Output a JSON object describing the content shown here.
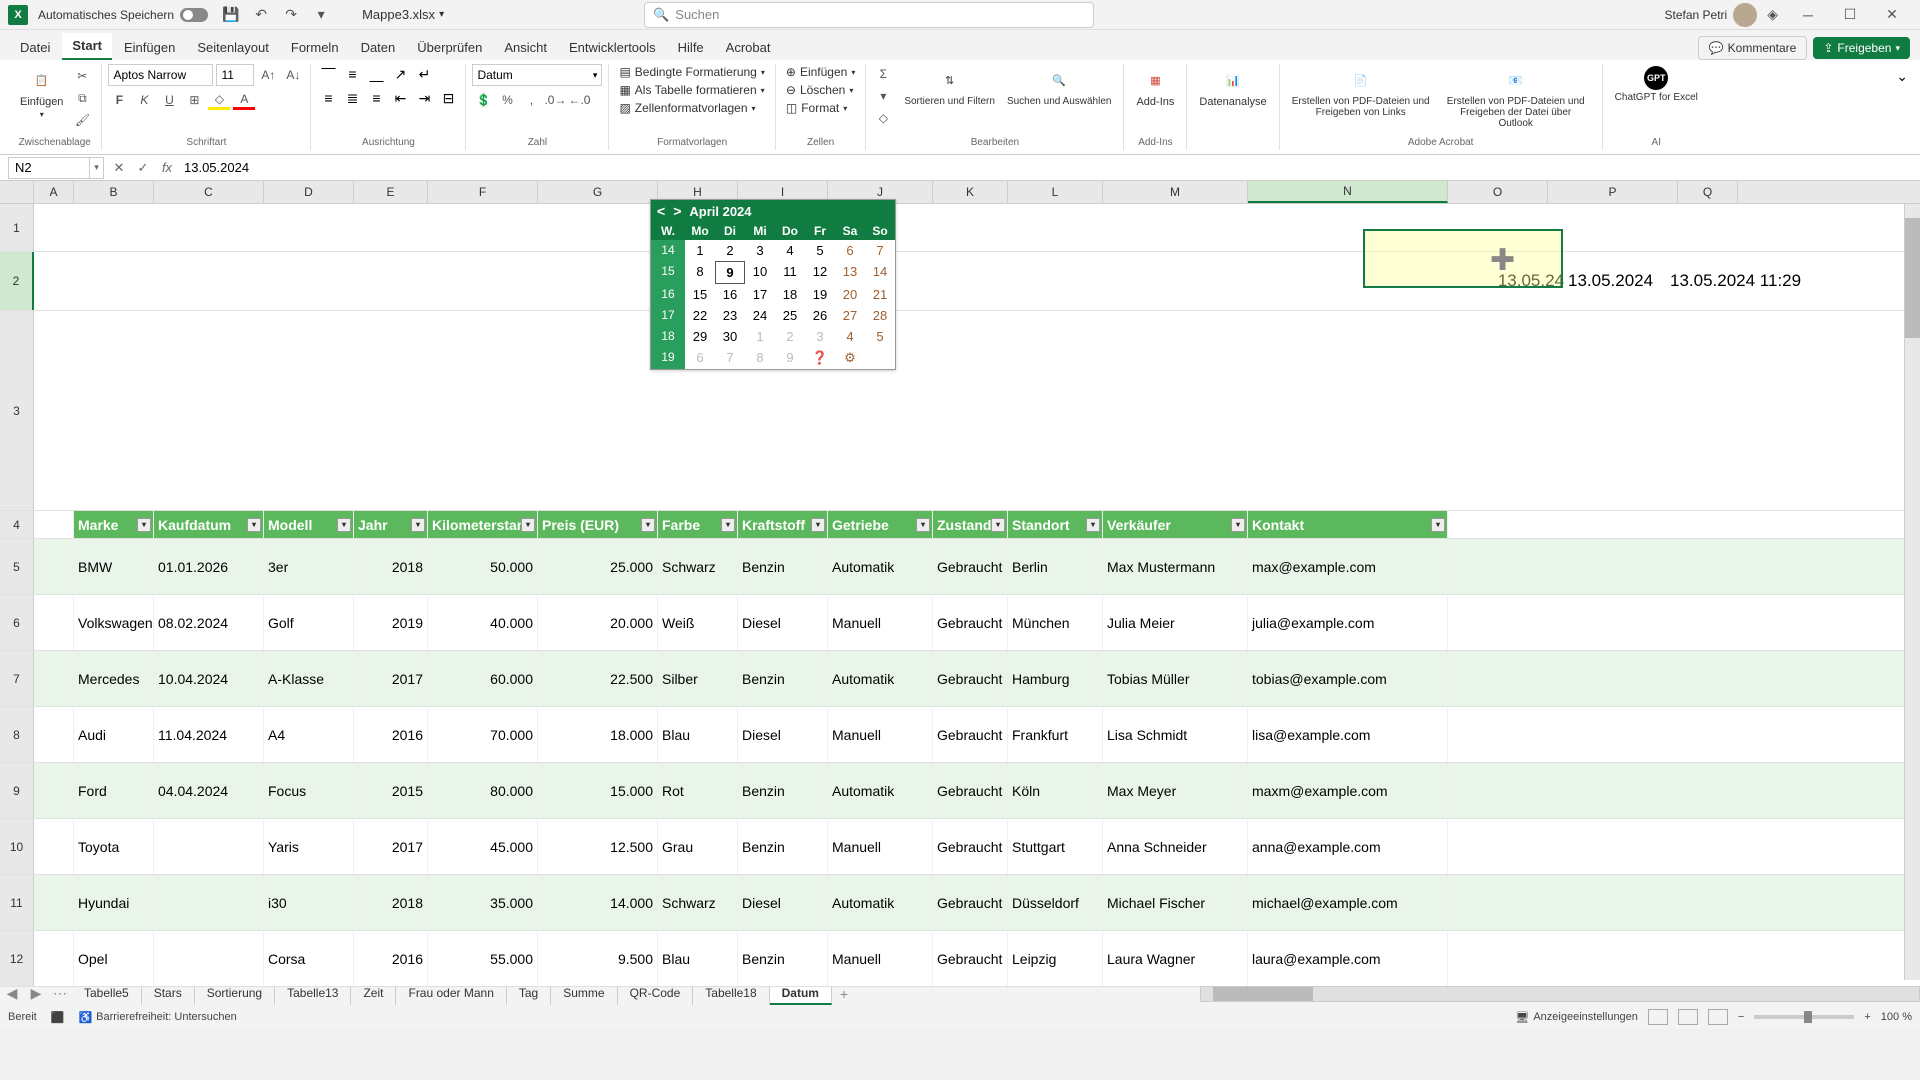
{
  "titlebar": {
    "autosave": "Automatisches Speichern",
    "filename": "Mappe3.xlsx",
    "search_placeholder": "Suchen",
    "user": "Stefan Petri"
  },
  "menubar": {
    "tabs": [
      "Datei",
      "Start",
      "Einfügen",
      "Seitenlayout",
      "Formeln",
      "Daten",
      "Überprüfen",
      "Ansicht",
      "Entwicklertools",
      "Hilfe",
      "Acrobat"
    ],
    "active": "Start",
    "comments": "Kommentare",
    "share": "Freigeben"
  },
  "ribbon": {
    "clipboard": {
      "paste": "Einfügen",
      "group": "Zwischenablage"
    },
    "font": {
      "name": "Aptos Narrow",
      "size": "11",
      "group": "Schriftart"
    },
    "alignment": {
      "group": "Ausrichtung"
    },
    "number": {
      "format": "Datum",
      "group": "Zahl"
    },
    "styles": {
      "cond": "Bedingte Formatierung",
      "table": "Als Tabelle formatieren",
      "cell": "Zellenformatvorlagen",
      "group": "Formatvorlagen"
    },
    "cells": {
      "insert": "Einfügen",
      "delete": "Löschen",
      "format": "Format",
      "group": "Zellen"
    },
    "editing": {
      "sort": "Sortieren und Filtern",
      "find": "Suchen und Auswählen",
      "group": "Bearbeiten"
    },
    "addins": {
      "addins": "Add-Ins",
      "group": "Add-Ins"
    },
    "analysis": {
      "data": "Datenanalyse"
    },
    "acrobat": {
      "pdf1": "Erstellen von PDF-Dateien und Freigeben von Links",
      "pdf2": "Erstellen von PDF-Dateien und Freigeben der Datei über Outlook",
      "group": "Adobe Acrobat"
    },
    "ai": {
      "gpt": "ChatGPT for Excel",
      "group": "AI"
    }
  },
  "formula_bar": {
    "namebox": "N2",
    "fx": "fx",
    "value": "13.05.2024"
  },
  "columns": [
    "A",
    "B",
    "C",
    "D",
    "E",
    "F",
    "G",
    "H",
    "I",
    "J",
    "K",
    "L",
    "M",
    "N",
    "O",
    "P",
    "Q"
  ],
  "calendar": {
    "title": "April 2024",
    "days": [
      "W.",
      "Mo",
      "Di",
      "Mi",
      "Do",
      "Fr",
      "Sa",
      "So"
    ],
    "weeks": [
      {
        "wn": "14",
        "d": [
          "1",
          "2",
          "3",
          "4",
          "5",
          "6",
          "7"
        ]
      },
      {
        "wn": "15",
        "d": [
          "8",
          "9",
          "10",
          "11",
          "12",
          "13",
          "14"
        ]
      },
      {
        "wn": "16",
        "d": [
          "15",
          "16",
          "17",
          "18",
          "19",
          "20",
          "21"
        ]
      },
      {
        "wn": "17",
        "d": [
          "22",
          "23",
          "24",
          "25",
          "26",
          "27",
          "28"
        ]
      },
      {
        "wn": "18",
        "d": [
          "29",
          "30",
          "1",
          "2",
          "3",
          "4",
          "5"
        ]
      },
      {
        "wn": "19",
        "d": [
          "6",
          "7",
          "8",
          "9",
          "",
          ""
        ]
      }
    ]
  },
  "cells": {
    "N2": "13.05.24",
    "O2": "13.05.2024",
    "P2": "13.05.2024 11:29"
  },
  "table": {
    "headers": [
      "Marke",
      "Kaufdatum",
      "Modell",
      "Jahr",
      "Kilometerstand",
      "Preis (EUR)",
      "Farbe",
      "Kraftstoff",
      "Getriebe",
      "Zustand",
      "Standort",
      "Verkäufer",
      "Kontakt"
    ],
    "rows": [
      [
        "BMW",
        "01.01.2026",
        "3er",
        "2018",
        "50.000",
        "25.000",
        "Schwarz",
        "Benzin",
        "Automatik",
        "Gebraucht",
        "Berlin",
        "Max Mustermann",
        "max@example.com"
      ],
      [
        "Volkswagen",
        "08.02.2024",
        "Golf",
        "2019",
        "40.000",
        "20.000",
        "Weiß",
        "Diesel",
        "Manuell",
        "Gebraucht",
        "München",
        "Julia Meier",
        "julia@example.com"
      ],
      [
        "Mercedes",
        "10.04.2024",
        "A-Klasse",
        "2017",
        "60.000",
        "22.500",
        "Silber",
        "Benzin",
        "Automatik",
        "Gebraucht",
        "Hamburg",
        "Tobias Müller",
        "tobias@example.com"
      ],
      [
        "Audi",
        "11.04.2024",
        "A4",
        "2016",
        "70.000",
        "18.000",
        "Blau",
        "Diesel",
        "Manuell",
        "Gebraucht",
        "Frankfurt",
        "Lisa Schmidt",
        "lisa@example.com"
      ],
      [
        "Ford",
        "04.04.2024",
        "Focus",
        "2015",
        "80.000",
        "15.000",
        "Rot",
        "Benzin",
        "Automatik",
        "Gebraucht",
        "Köln",
        "Max Meyer",
        "maxm@example.com"
      ],
      [
        "Toyota",
        "",
        "Yaris",
        "2017",
        "45.000",
        "12.500",
        "Grau",
        "Benzin",
        "Manuell",
        "Gebraucht",
        "Stuttgart",
        "Anna Schneider",
        "anna@example.com"
      ],
      [
        "Hyundai",
        "",
        "i30",
        "2018",
        "35.000",
        "14.000",
        "Schwarz",
        "Diesel",
        "Automatik",
        "Gebraucht",
        "Düsseldorf",
        "Michael Fischer",
        "michael@example.com"
      ],
      [
        "Opel",
        "",
        "Corsa",
        "2016",
        "55.000",
        "9.500",
        "Blau",
        "Benzin",
        "Manuell",
        "Gebraucht",
        "Leipzig",
        "Laura Wagner",
        "laura@example.com"
      ]
    ]
  },
  "sheets": [
    "Tabelle5",
    "Stars",
    "Sortierung",
    "Tabelle13",
    "Zeit",
    "Frau oder Mann",
    "Tag",
    "Summe",
    "QR-Code",
    "Tabelle18",
    "Datum"
  ],
  "active_sheet": "Datum",
  "status": {
    "ready": "Bereit",
    "access": "Barrierefreiheit: Untersuchen",
    "display": "Anzeigeeinstellungen",
    "zoom": "100 %"
  }
}
